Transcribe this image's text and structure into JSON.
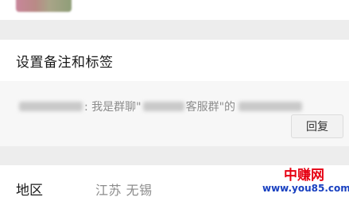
{
  "settings": {
    "label": "设置备注和标签"
  },
  "message": {
    "text_before": ": 我是群聊\"",
    "text_middle": "客服群\"的"
  },
  "reply_button": {
    "label": "回复"
  },
  "region": {
    "label": "地区",
    "value": "江苏  无锡"
  },
  "watermark": {
    "title": "中赚网",
    "url": "www.you85.com"
  },
  "colors": {
    "background": "#ededed",
    "watermark_red": "#e60012",
    "watermark_blue": "#1840c0"
  }
}
